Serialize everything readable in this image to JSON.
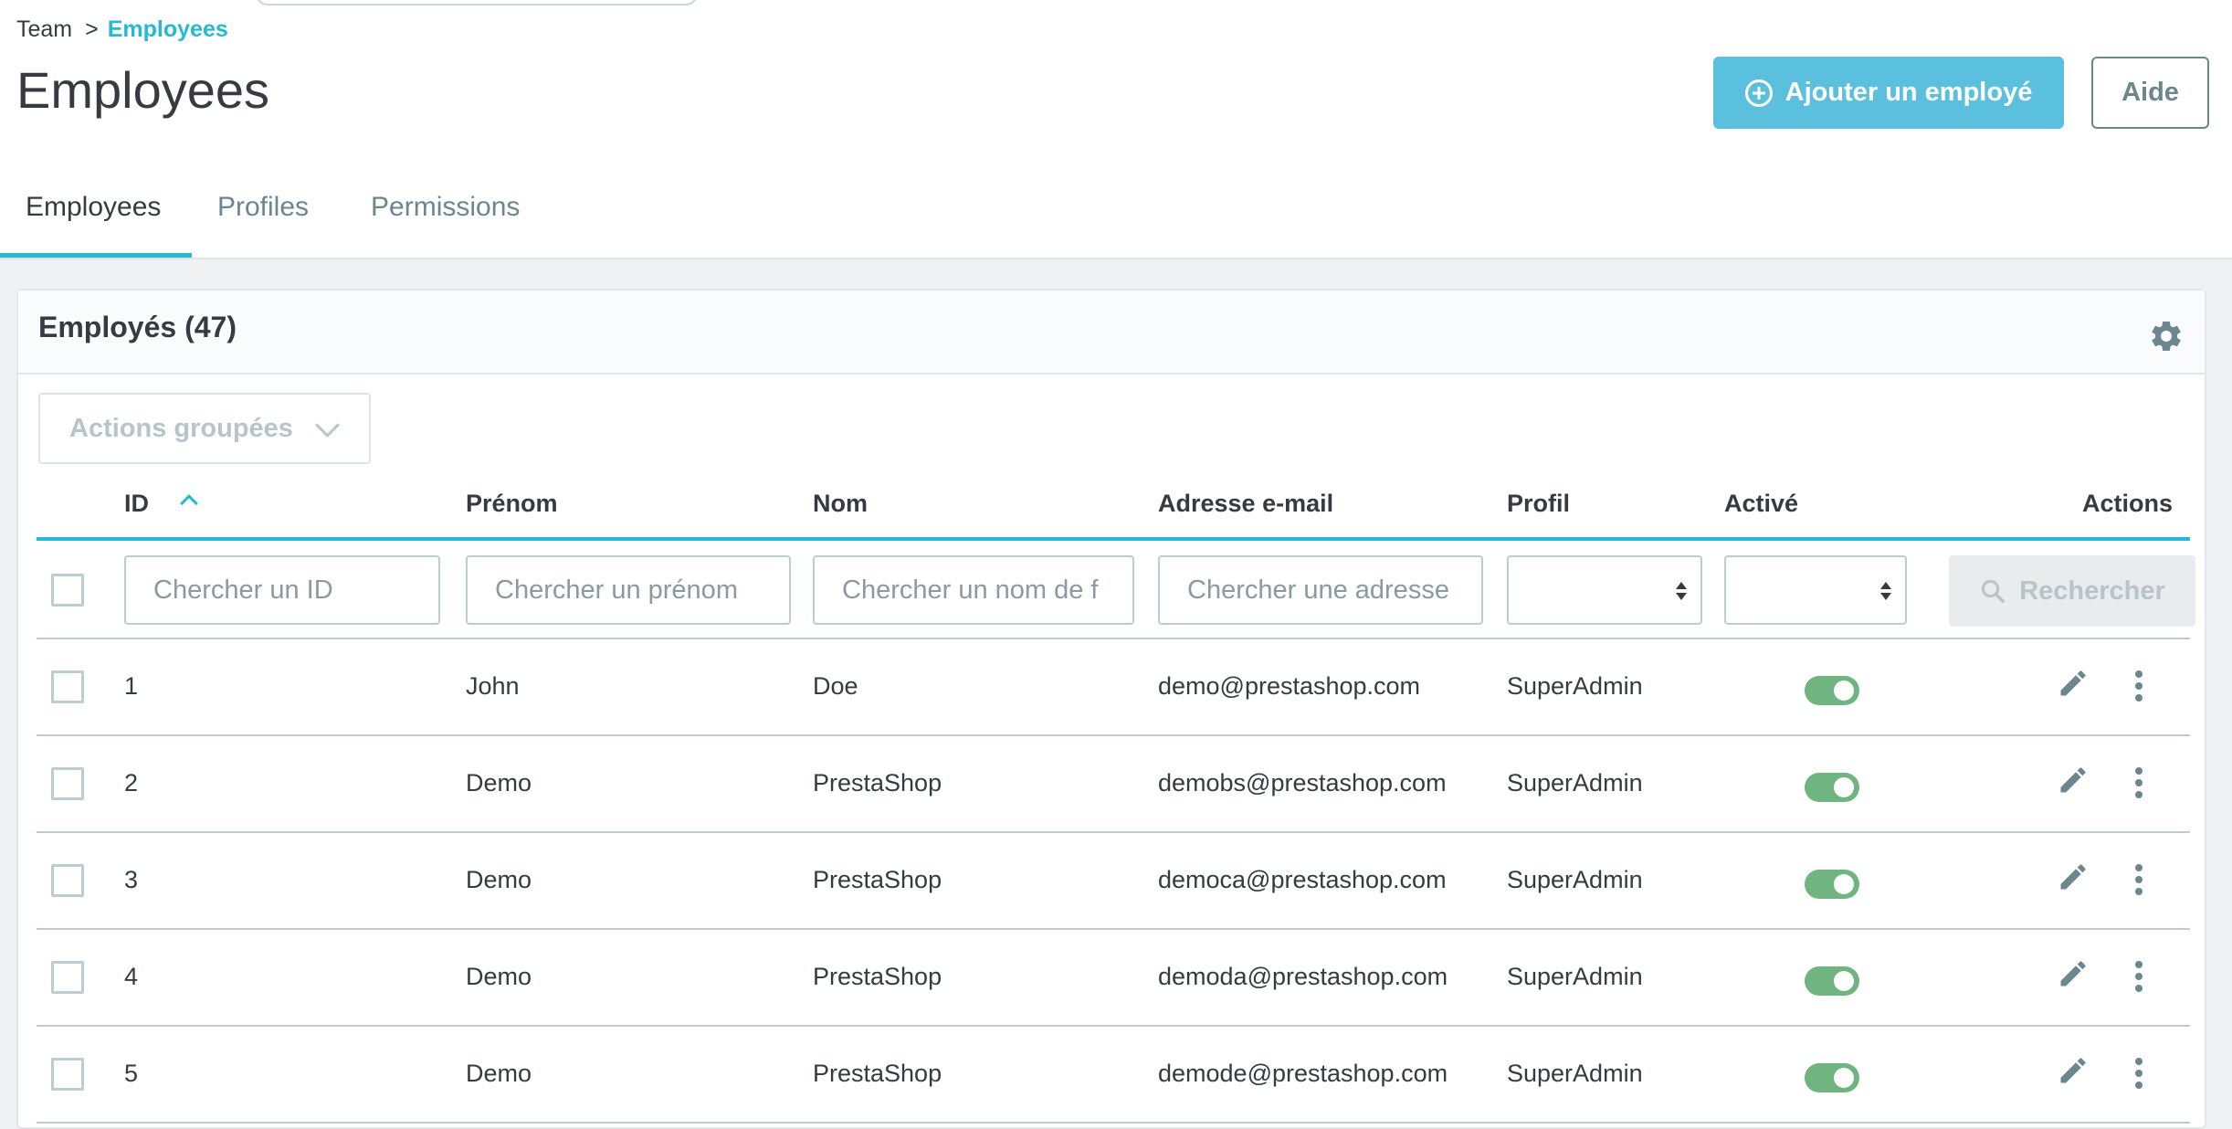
{
  "breadcrumb": {
    "parent": "Team",
    "separator": ">",
    "current": "Employees"
  },
  "page_title": "Employees",
  "header_buttons": {
    "add_label": "Ajouter un employé",
    "help_label": "Aide"
  },
  "tabs": [
    {
      "label": "Employees",
      "active": true
    },
    {
      "label": "Profiles",
      "active": false
    },
    {
      "label": "Permissions",
      "active": false
    }
  ],
  "card": {
    "title": "Employés (47)",
    "bulk_actions_label": "Actions groupées"
  },
  "table": {
    "columns": {
      "id": "ID",
      "firstname": "Prénom",
      "lastname": "Nom",
      "email": "Adresse e-mail",
      "profile": "Profil",
      "active": "Activé",
      "actions": "Actions"
    },
    "sort": {
      "column": "ID",
      "direction": "asc"
    },
    "filters": {
      "id_placeholder": "Chercher un ID",
      "firstname_placeholder": "Chercher un prénom",
      "lastname_placeholder": "Chercher un nom de f",
      "email_placeholder": "Chercher une adresse",
      "profile_value": "",
      "active_value": "",
      "search_label": "Rechercher"
    },
    "rows": [
      {
        "id": "1",
        "firstname": "John",
        "lastname": "Doe",
        "email": "demo@prestashop.com",
        "profile": "SuperAdmin",
        "active": true
      },
      {
        "id": "2",
        "firstname": "Demo",
        "lastname": "PrestaShop",
        "email": "demobs@prestashop.com",
        "profile": "SuperAdmin",
        "active": true
      },
      {
        "id": "3",
        "firstname": "Demo",
        "lastname": "PrestaShop",
        "email": "democa@prestashop.com",
        "profile": "SuperAdmin",
        "active": true
      },
      {
        "id": "4",
        "firstname": "Demo",
        "lastname": "PrestaShop",
        "email": "demoda@prestashop.com",
        "profile": "SuperAdmin",
        "active": true
      },
      {
        "id": "5",
        "firstname": "Demo",
        "lastname": "PrestaShop",
        "email": "demode@prestashop.com",
        "profile": "SuperAdmin",
        "active": true
      }
    ]
  },
  "colors": {
    "accent": "#25b9d7",
    "primary_button": "#5bc0de",
    "toggle_on": "#70b580",
    "text": "#363a41",
    "muted": "#6c868e"
  }
}
